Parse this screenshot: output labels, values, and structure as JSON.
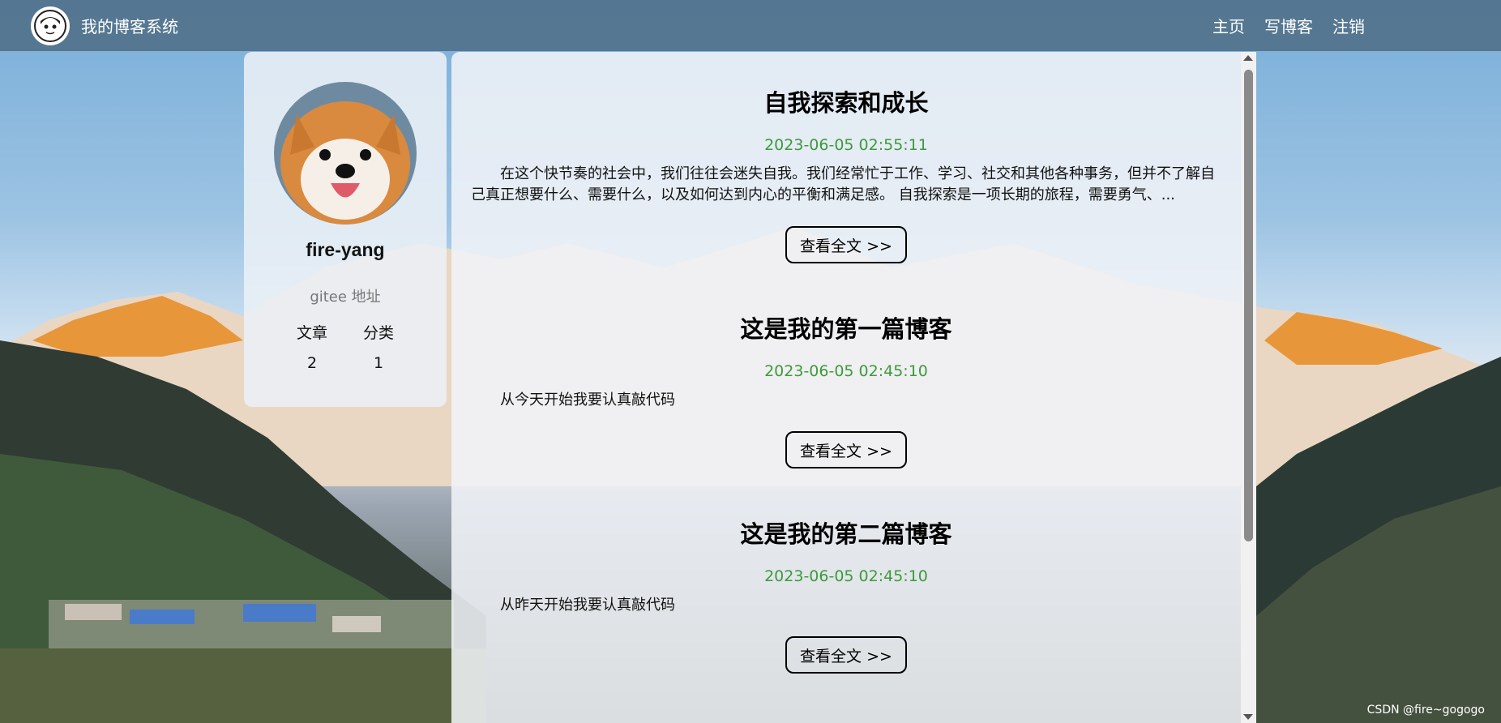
{
  "nav": {
    "logo_icon": "cartoon-avatar-icon",
    "site_title": "我的博客系统",
    "links": [
      "主页",
      "写博客",
      "注销"
    ]
  },
  "profile": {
    "avatar_icon": "dog-avatar-icon",
    "name": "fire-yang",
    "gitee_link": "gitee 地址",
    "stats_labels": [
      "文章",
      "分类"
    ],
    "stats_values": [
      "2",
      "1"
    ]
  },
  "posts": [
    {
      "title": "自我探索和成长",
      "date": "2023-06-05 02:55:11",
      "desc": "在这个快节奏的社会中，我们往往会迷失自我。我们经常忙于工作、学习、社交和其他各种事务，但并不了解自己真正想要什么、需要什么，以及如何达到内心的平衡和满足感。 自我探索是一项长期的旅程，需要勇气、...",
      "button": "查看全文 >>"
    },
    {
      "title": "这是我的第一篇博客",
      "date": "2023-06-05 02:45:10",
      "desc": "从今天开始我要认真敲代码",
      "button": "查看全文 >>"
    },
    {
      "title": "这是我的第二篇博客",
      "date": "2023-06-05 02:45:10",
      "desc": "从昨天开始我要认真敲代码",
      "button": "查看全文 >>"
    }
  ],
  "watermark": "CSDN @fire~gogogo"
}
